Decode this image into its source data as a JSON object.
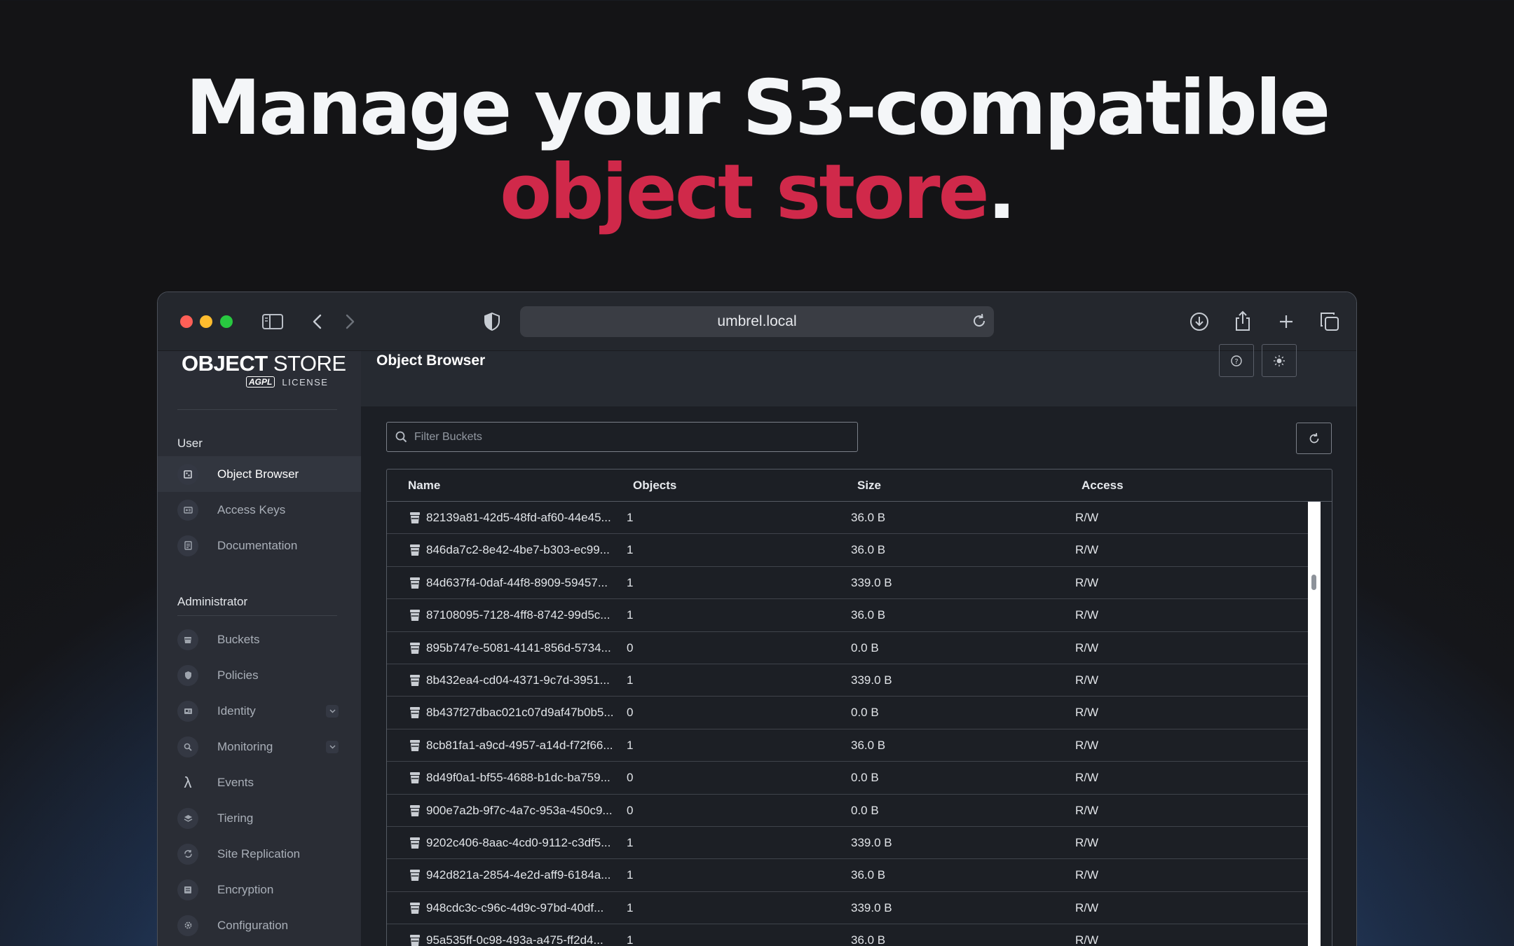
{
  "hero": {
    "line1": "Manage your S3-compatible",
    "line2_accent": "object store",
    "line2_end": ".",
    "accent_color": "#d0294a"
  },
  "browser": {
    "url": "umbrel.local",
    "traffic_lights": [
      "#fe5f57",
      "#febc2e",
      "#28c840"
    ]
  },
  "sidebar": {
    "logo_bold": "OBJECT",
    "logo_thin": "STORE",
    "logo_badge": "AGPL",
    "logo_license": "LICENSE",
    "user_section": "User",
    "user_items": [
      {
        "label": "Object Browser",
        "icon": "object-browser-icon"
      },
      {
        "label": "Access Keys",
        "icon": "key-icon"
      },
      {
        "label": "Documentation",
        "icon": "document-icon"
      }
    ],
    "admin_section": "Administrator",
    "admin_items": [
      {
        "label": "Buckets",
        "icon": "bucket-icon"
      },
      {
        "label": "Policies",
        "icon": "shield-icon"
      },
      {
        "label": "Identity",
        "icon": "id-card-icon"
      },
      {
        "label": "Monitoring",
        "icon": "magnifier-icon"
      },
      {
        "label": "Events",
        "icon": "lambda-icon"
      },
      {
        "label": "Tiering",
        "icon": "layers-icon"
      },
      {
        "label": "Site Replication",
        "icon": "sync-icon"
      },
      {
        "label": "Encryption",
        "icon": "lock-icon"
      },
      {
        "label": "Configuration",
        "icon": "gear-icon"
      }
    ]
  },
  "main": {
    "title": "Object Browser",
    "filter_placeholder": "Filter Buckets",
    "columns": [
      "Name",
      "Objects",
      "Size",
      "Access"
    ],
    "rows": [
      {
        "name": "82139a81-42d5-48fd-af60-44e45...",
        "objects": "1",
        "size": "36.0 B",
        "access": "R/W"
      },
      {
        "name": "846da7c2-8e42-4be7-b303-ec99...",
        "objects": "1",
        "size": "36.0 B",
        "access": "R/W"
      },
      {
        "name": "84d637f4-0daf-44f8-8909-59457...",
        "objects": "1",
        "size": "339.0 B",
        "access": "R/W"
      },
      {
        "name": "87108095-7128-4ff8-8742-99d5c...",
        "objects": "1",
        "size": "36.0 B",
        "access": "R/W"
      },
      {
        "name": "895b747e-5081-4141-856d-5734...",
        "objects": "0",
        "size": "0.0 B",
        "access": "R/W"
      },
      {
        "name": "8b432ea4-cd04-4371-9c7d-3951...",
        "objects": "1",
        "size": "339.0 B",
        "access": "R/W"
      },
      {
        "name": "8b437f27dbac021c07d9af47b0b5...",
        "objects": "0",
        "size": "0.0 B",
        "access": "R/W"
      },
      {
        "name": "8cb81fa1-a9cd-4957-a14d-f72f66...",
        "objects": "1",
        "size": "36.0 B",
        "access": "R/W"
      },
      {
        "name": "8d49f0a1-bf55-4688-b1dc-ba759...",
        "objects": "0",
        "size": "0.0 B",
        "access": "R/W"
      },
      {
        "name": "900e7a2b-9f7c-4a7c-953a-450c9...",
        "objects": "0",
        "size": "0.0 B",
        "access": "R/W"
      },
      {
        "name": "9202c406-8aac-4cd0-9112-c3df5...",
        "objects": "1",
        "size": "339.0 B",
        "access": "R/W"
      },
      {
        "name": "942d821a-2854-4e2d-aff9-6184a...",
        "objects": "1",
        "size": "36.0 B",
        "access": "R/W"
      },
      {
        "name": "948cdc3c-c96c-4d9c-97bd-40df...",
        "objects": "1",
        "size": "339.0 B",
        "access": "R/W"
      },
      {
        "name": "95a535ff-0c98-493a-a475-ff2d4...",
        "objects": "1",
        "size": "36.0 B",
        "access": "R/W"
      }
    ]
  }
}
